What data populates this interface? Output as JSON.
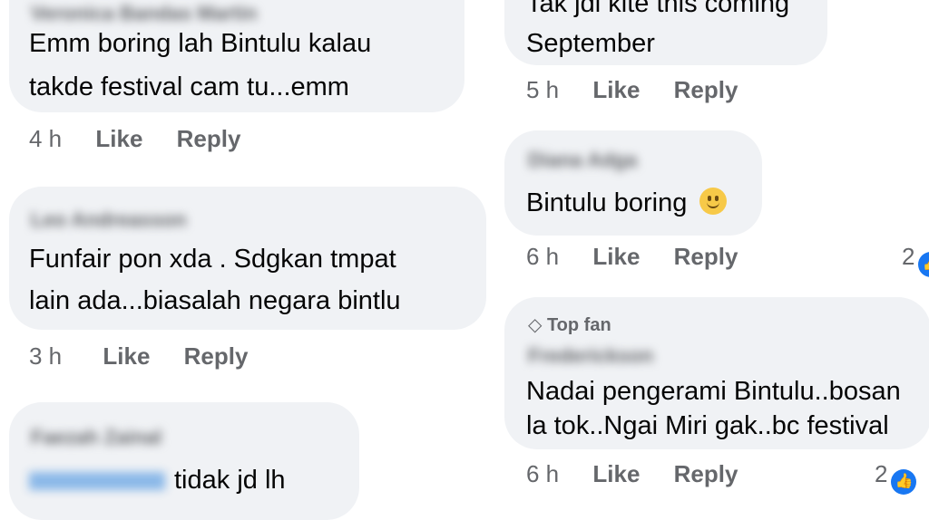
{
  "left": [
    {
      "name": "Veronica Bandas Martin",
      "lines": [
        "Emm boring lah Bintulu kalau",
        "takde festival cam tu...emm"
      ],
      "time": "4 h",
      "like": "Like",
      "reply": "Reply"
    },
    {
      "name": "Leo Andreasson",
      "lines": [
        "Funfair pon xda . Sdgkan tmpat",
        "lain ada...biasalah negara bintlu"
      ],
      "time": "3 h",
      "like": "Like",
      "reply": "Reply"
    },
    {
      "name": "Faezah Zainal",
      "lines": [
        "tidak jd lh"
      ]
    }
  ],
  "right": [
    {
      "lines": [
        "Tak jdi kite this coming",
        "September"
      ],
      "time": "5 h",
      "like": "Like",
      "reply": "Reply"
    },
    {
      "name": "Diana Adga",
      "lines": [
        "Bintulu boring"
      ],
      "emoji": "slightly-smiling-face-icon",
      "time": "6 h",
      "like": "Like",
      "reply": "Reply",
      "reactions": "2"
    },
    {
      "badge": "Top fan",
      "badge_icon": "diamond-icon",
      "name": "Frederickson",
      "lines": [
        "Nadai pengerami Bintulu..bosan",
        "la tok..Ngai Miri gak..bc festival"
      ],
      "time": "6 h",
      "like": "Like",
      "reply": "Reply",
      "reactions": "2"
    }
  ],
  "colors": {
    "bubble": "#f0f2f5",
    "meta": "#65676b",
    "text": "#050505",
    "like_blue": "#1877f2"
  }
}
